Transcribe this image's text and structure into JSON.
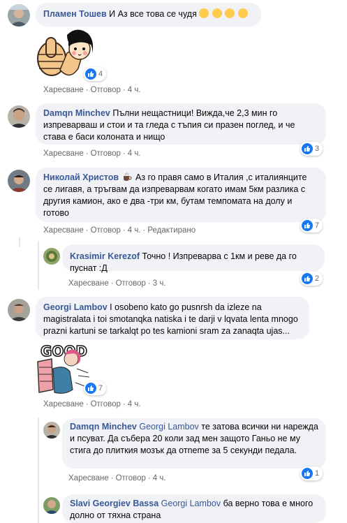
{
  "comments": [
    {
      "author": "Пламен Тошев",
      "text": "И Аз все това се чудя",
      "emojis": [
        "slightly-frowning-emoji",
        "thinking-emoji",
        "thinking-emoji",
        "slightly-frowning-emoji"
      ],
      "sticker": "thumbs-up-girl-sticker",
      "reactions": "4",
      "actions": {
        "like": "Харесване",
        "reply": "Отговор",
        "time": "4 ч."
      }
    },
    {
      "author": "Damqn Minchev",
      "text": "Пълни нещастници! Вижда,че 2,3 мин го изпреварваш и стои и та гледа с тъпия си празен поглед, и че става е баси колоната и нищо",
      "reactions": "3",
      "actions": {
        "like": "Харесване",
        "reply": "Отговор",
        "time": "4 ч."
      }
    },
    {
      "author": "Николай Христов",
      "badge_icon": "hot-beverage-icon",
      "text": "Аз го правя само в Италия ,с италиянците се лигавя, а тръгвам да изпреварвам когато имам 5км разлика с другия камион, ако е два -три км, бутам темпомата на долу и готово",
      "reactions": "7",
      "actions": {
        "like": "Харесване",
        "reply": "Отговор",
        "time": "4 ч.",
        "edited": "Редактирано"
      }
    },
    {
      "author": "Krasimir Kerezof",
      "text": "Точно ! Изпреварва с 1км и реве да го пуснат :Д",
      "reactions": "2",
      "actions": {
        "like": "Харесване",
        "reply": "Отговор",
        "time": "3 ч."
      }
    },
    {
      "author": "Georgi Lambov",
      "text": "I osobeno kato go pusnrsh da izleze na magistralata i toi smotanqka natiska i te darji v lqvata lenta mnogo prazni kartuni se tarkalqt po tes kamioni sram za zanaqta ujas...",
      "sticker": "good-cartoon-sticker",
      "sticker_text": "GOOD",
      "reactions": "7",
      "actions": {
        "like": "Харесване",
        "reply": "Отговор",
        "time": "4 ч."
      }
    },
    {
      "author": "Damqn Minchev",
      "mention": "Georgi Lambov",
      "text": "те затова всички ни нарежда и псуват. Да събера 20 коли зад мен защото Ганьо не му стига до плиткия мозък да отneme за 5 секунди педала.",
      "reactions": "1",
      "actions": {
        "like": "Харесване",
        "reply": "Отговор",
        "time": "4 ч."
      }
    },
    {
      "author": "Slavi Georgiev Bassa",
      "mention": "Georgi Lambov",
      "text": "ба верно това е много долно от тяхна страна"
    }
  ],
  "colors": {
    "author": "#385898",
    "bubble": "#f0f2f5",
    "meta": "#65676b",
    "like": "#1877f2"
  }
}
